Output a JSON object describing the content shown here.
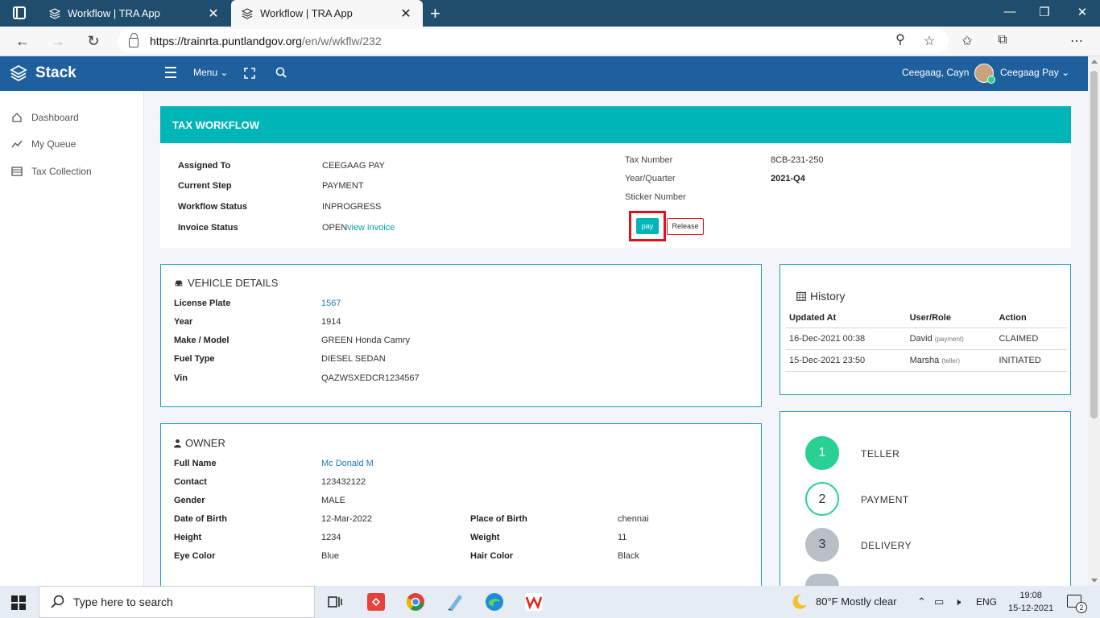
{
  "browser": {
    "tabs": [
      {
        "title": "Workflow | TRA App",
        "active": false
      },
      {
        "title": "Workflow | TRA App",
        "active": true
      }
    ],
    "url_domain": "https://trainrta.puntlandgov.org",
    "url_path": "/en/w/wkflw/232"
  },
  "header": {
    "brand": "Stack",
    "menu_label": "Menu",
    "user_name": "Ceegaag, Cayn",
    "user_role": "Ceegaag Pay"
  },
  "sidebar": {
    "items": [
      {
        "label": "Dashboard",
        "icon": "home-icon"
      },
      {
        "label": "My Queue",
        "icon": "trend-icon"
      },
      {
        "label": "Tax Collection",
        "icon": "list-icon"
      }
    ]
  },
  "tax_workflow": {
    "title": "TAX WORKFLOW",
    "assigned_to_label": "Assigned To",
    "assigned_to": "CEEGAAG PAY",
    "current_step_label": "Current Step",
    "current_step": "PAYMENT",
    "workflow_status_label": "Workflow Status",
    "workflow_status": "INPROGRESS",
    "invoice_status_label": "Invoice Status",
    "invoice_status": "OPEN",
    "view_invoice": "view invoice",
    "tax_number_label": "Tax Number",
    "tax_number": "8CB-231-250",
    "year_quarter_label": "Year/Quarter",
    "year_quarter": "2021-Q4",
    "sticker_number_label": "Sticker Number",
    "pay_label": "pay",
    "release_label": "Release"
  },
  "vehicle": {
    "title": "VEHICLE DETAILS",
    "license_plate_label": "License Plate",
    "license_plate": "1567",
    "year_label": "Year",
    "year": "1914",
    "make_model_label": "Make / Model",
    "make_model": "GREEN Honda Camry",
    "fuel_type_label": "Fuel Type",
    "fuel_type": "DIESEL SEDAN",
    "vin_label": "Vin",
    "vin": "QAZWSXEDCR1234567"
  },
  "owner": {
    "title": "OWNER",
    "full_name_label": "Full Name",
    "full_name": "Mc Donald M",
    "contact_label": "Contact",
    "contact": "123432122",
    "gender_label": "Gender",
    "gender": "MALE",
    "dob_label": "Date of Birth",
    "dob": "12-Mar-2022",
    "pob_label": "Place of Birth",
    "pob": "chennai",
    "height_label": "Height",
    "height": "1234",
    "weight_label": "Weight",
    "weight": "11",
    "eye_color_label": "Eye Color",
    "eye_color": "Blue",
    "hair_color_label": "Hair Color",
    "hair_color": "Black"
  },
  "history": {
    "title": "History",
    "columns": [
      "Updated At",
      "User/Role",
      "Action"
    ],
    "rows": [
      {
        "updated_at": "16-Dec-2021 00:38",
        "user": "David",
        "role": "(payment)",
        "action": "CLAIMED"
      },
      {
        "updated_at": "15-Dec-2021 23:50",
        "user": "Marsha",
        "role": "(teller)",
        "action": "INITIATED"
      }
    ]
  },
  "steps": [
    {
      "number": "1",
      "label": "TELLER",
      "state": "done"
    },
    {
      "number": "2",
      "label": "PAYMENT",
      "state": "current"
    },
    {
      "number": "3",
      "label": "DELIVERY",
      "state": "todo"
    }
  ],
  "taskbar": {
    "search_placeholder": "Type here to search",
    "weather": "80°F  Mostly clear",
    "language": "ENG",
    "time": "19:08",
    "date": "15-12-2021",
    "notifications": "2"
  },
  "colors": {
    "header_blue": "#1e5f9e",
    "teal": "#00b5b8",
    "green": "#28d094",
    "highlight_red": "#e0131b"
  }
}
